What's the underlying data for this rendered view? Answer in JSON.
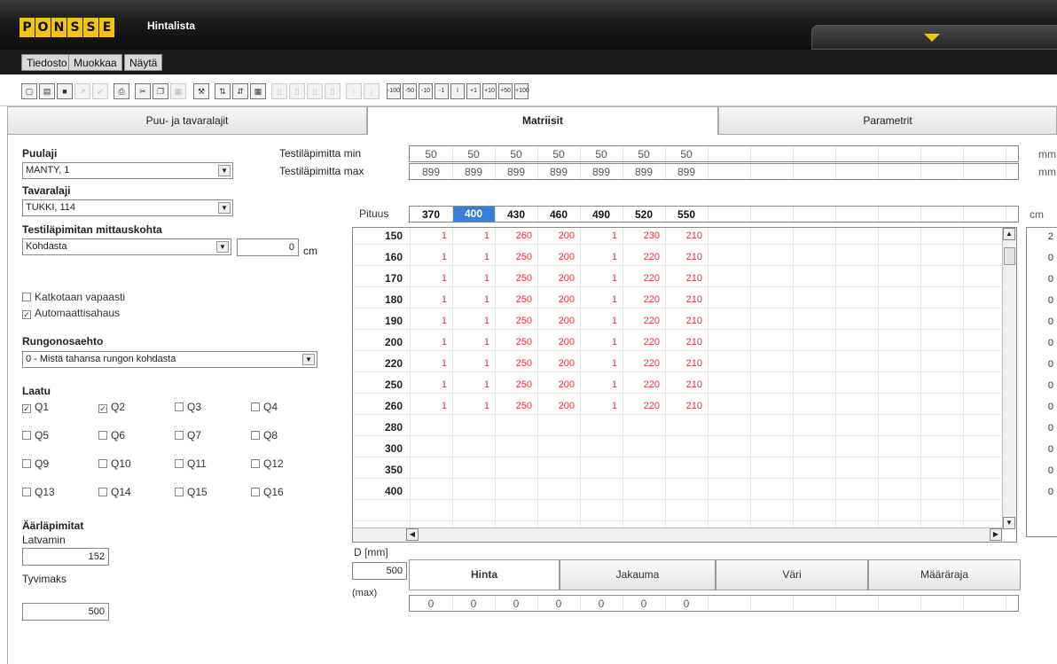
{
  "app": {
    "logo_letters": [
      "P",
      "O",
      "N",
      "S",
      "S",
      "E"
    ],
    "title": "Hintalista"
  },
  "menu": [
    "Tiedosto",
    "Muokkaa",
    "Näytä"
  ],
  "toolbar": {
    "step_buttons": [
      "-100",
      "-50",
      "-10",
      "-1",
      "I",
      "+1",
      "+10",
      "+50",
      "+100"
    ]
  },
  "tabs": [
    "Puu- ja tavaralajit",
    "Matriisit",
    "Parametrit"
  ],
  "left": {
    "puulaji_label": "Puulaji",
    "puulaji_value": "MANTY, 1",
    "tavaralaji_label": "Tavaralaji",
    "tavaralaji_value": "TUKKI, 114",
    "mittauskohta_label": "Testiläpimitan mittauskohta",
    "mittauskohta_value": "Kohdasta",
    "mittauskohta_offset": "0",
    "mittauskohta_unit": "cm",
    "katkotaan_label": "Katkotaan vapaasti",
    "automaatti_label": "Automaattisahaus",
    "rungonosa_label": "Rungonosaehto",
    "rungonosa_value": "0 - Mistä tahansa rungon kohdasta",
    "laatu_label": "Laatu",
    "quality": [
      {
        "label": "Q1",
        "checked": true
      },
      {
        "label": "Q2",
        "checked": true
      },
      {
        "label": "Q3",
        "checked": false
      },
      {
        "label": "Q4",
        "checked": false
      },
      {
        "label": "Q5",
        "checked": false
      },
      {
        "label": "Q6",
        "checked": false
      },
      {
        "label": "Q7",
        "checked": false
      },
      {
        "label": "Q8",
        "checked": false
      },
      {
        "label": "Q9",
        "checked": false
      },
      {
        "label": "Q10",
        "checked": false
      },
      {
        "label": "Q11",
        "checked": false
      },
      {
        "label": "Q12",
        "checked": false
      },
      {
        "label": "Q13",
        "checked": false
      },
      {
        "label": "Q14",
        "checked": false
      },
      {
        "label": "Q15",
        "checked": false
      },
      {
        "label": "Q16",
        "checked": false
      }
    ],
    "aarilapimitat_label": "Äärläpimitat",
    "latvamin_label": "Latvamin",
    "latvamin_value": "152",
    "tyvimaks_label": "Tyvimaks",
    "tyvimaks_value": "500"
  },
  "matrix": {
    "test_min_label": "Testiläpimitta min",
    "test_min": [
      "50",
      "50",
      "50",
      "50",
      "50",
      "50",
      "50"
    ],
    "test_max_label": "Testiläpimitta max",
    "test_max": [
      "899",
      "899",
      "899",
      "899",
      "899",
      "899",
      "899"
    ],
    "unit_mm": "mm",
    "pituus_label": "Pituus",
    "lengths": [
      "370",
      "400",
      "430",
      "460",
      "490",
      "520",
      "550"
    ],
    "unit_cm": "cm",
    "diameters": [
      "150",
      "160",
      "170",
      "180",
      "190",
      "200",
      "220",
      "250",
      "260",
      "280",
      "300",
      "350",
      "400"
    ],
    "prices": [
      [
        "1",
        "1",
        "260",
        "200",
        "1",
        "230",
        "210"
      ],
      [
        "1",
        "1",
        "250",
        "200",
        "1",
        "220",
        "210"
      ],
      [
        "1",
        "1",
        "250",
        "200",
        "1",
        "220",
        "210"
      ],
      [
        "1",
        "1",
        "250",
        "200",
        "1",
        "220",
        "210"
      ],
      [
        "1",
        "1",
        "250",
        "200",
        "1",
        "220",
        "210"
      ],
      [
        "1",
        "1",
        "250",
        "200",
        "1",
        "220",
        "210"
      ],
      [
        "1",
        "1",
        "250",
        "200",
        "1",
        "220",
        "210"
      ],
      [
        "1",
        "1",
        "250",
        "200",
        "1",
        "220",
        "210"
      ],
      [
        "1",
        "1",
        "250",
        "200",
        "1",
        "220",
        "210"
      ]
    ],
    "right_values": [
      "2",
      "0",
      "0",
      "0",
      "0",
      "0",
      "0",
      "0",
      "0",
      "0",
      "0",
      "0",
      "0"
    ],
    "d_label": "D [mm]",
    "d_value": "500",
    "max_label": "(max)",
    "max_values": [
      "0",
      "0",
      "0",
      "0",
      "0",
      "0",
      "0"
    ],
    "bottom_tabs": [
      "Hinta",
      "Jakauma",
      "Väri",
      "Määräraja"
    ]
  }
}
